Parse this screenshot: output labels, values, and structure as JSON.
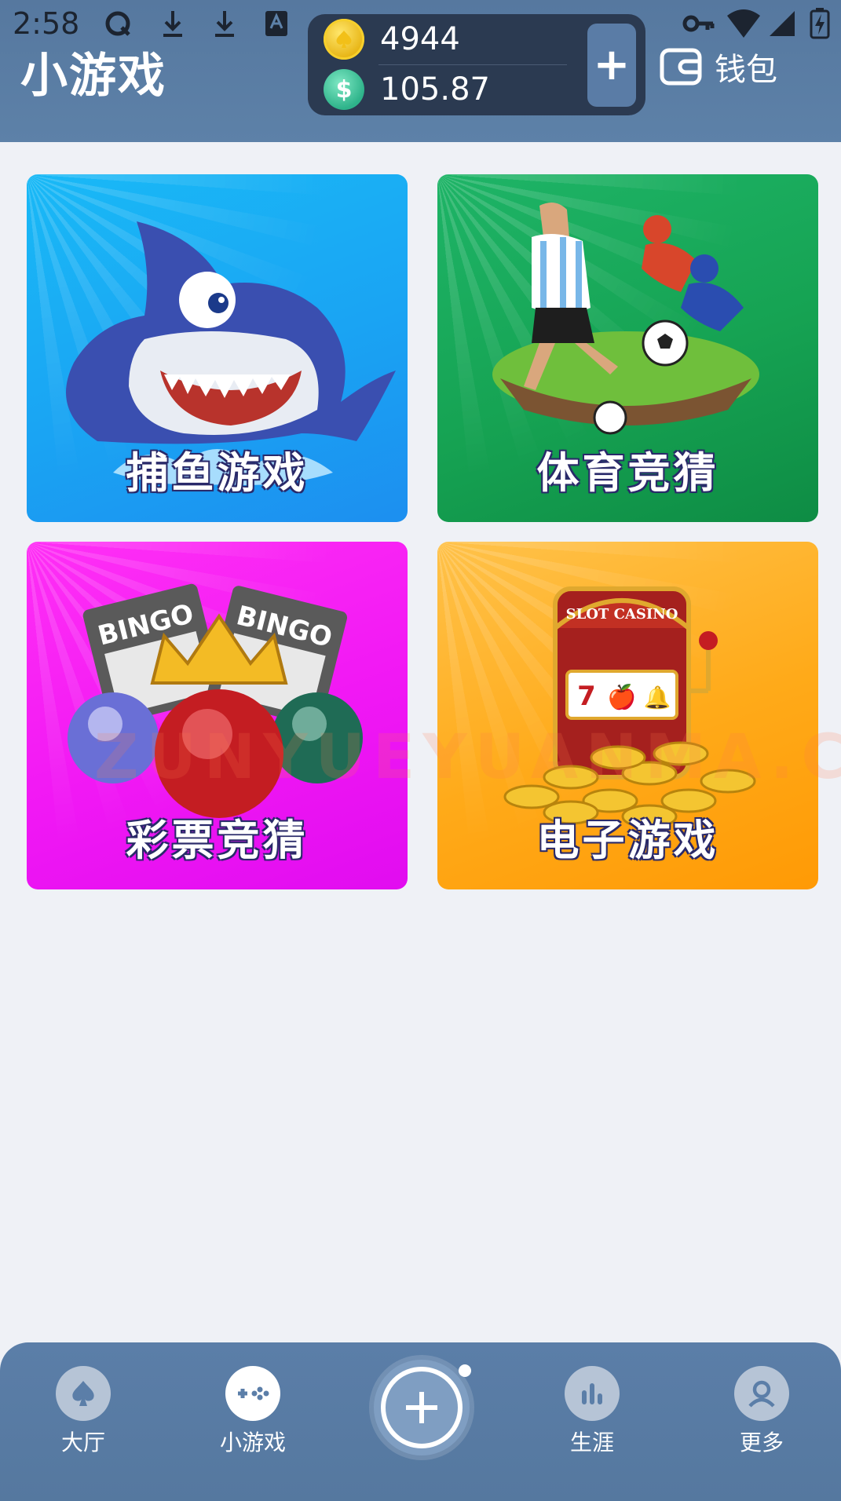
{
  "status_bar": {
    "time": "2:58"
  },
  "header": {
    "title": "小游戏",
    "coins": "4944",
    "cash": "105.87",
    "cash_symbol": "$",
    "add_label": "+",
    "wallet_label": "钱包"
  },
  "games": [
    {
      "label": "捕鱼游戏"
    },
    {
      "label": "体育竞猜"
    },
    {
      "label": "彩票竞猜"
    },
    {
      "label": "电子游戏"
    }
  ],
  "game_art_text": {
    "bingo_1": "BINGO",
    "bingo_2": "BINGO",
    "slot_sign": "SLOT CASINO",
    "slot_reels": [
      "7",
      "🍎",
      "🔔"
    ]
  },
  "watermark": "ZUNYUEYUANMA.COM",
  "bottom_nav": {
    "items": [
      {
        "label": "大厅"
      },
      {
        "label": "小游戏"
      },
      {
        "label": "生涯"
      },
      {
        "label": "更多"
      }
    ],
    "active_index": 1
  },
  "colors": {
    "header_bg": "#5a7ca6",
    "balance_bg": "#2b3a51",
    "page_bg": "#eff1f6",
    "fish_card": "#1aa4f3",
    "sport_card": "#16a353",
    "lottery_card": "#f118f4",
    "slot_card": "#ffaa19"
  }
}
